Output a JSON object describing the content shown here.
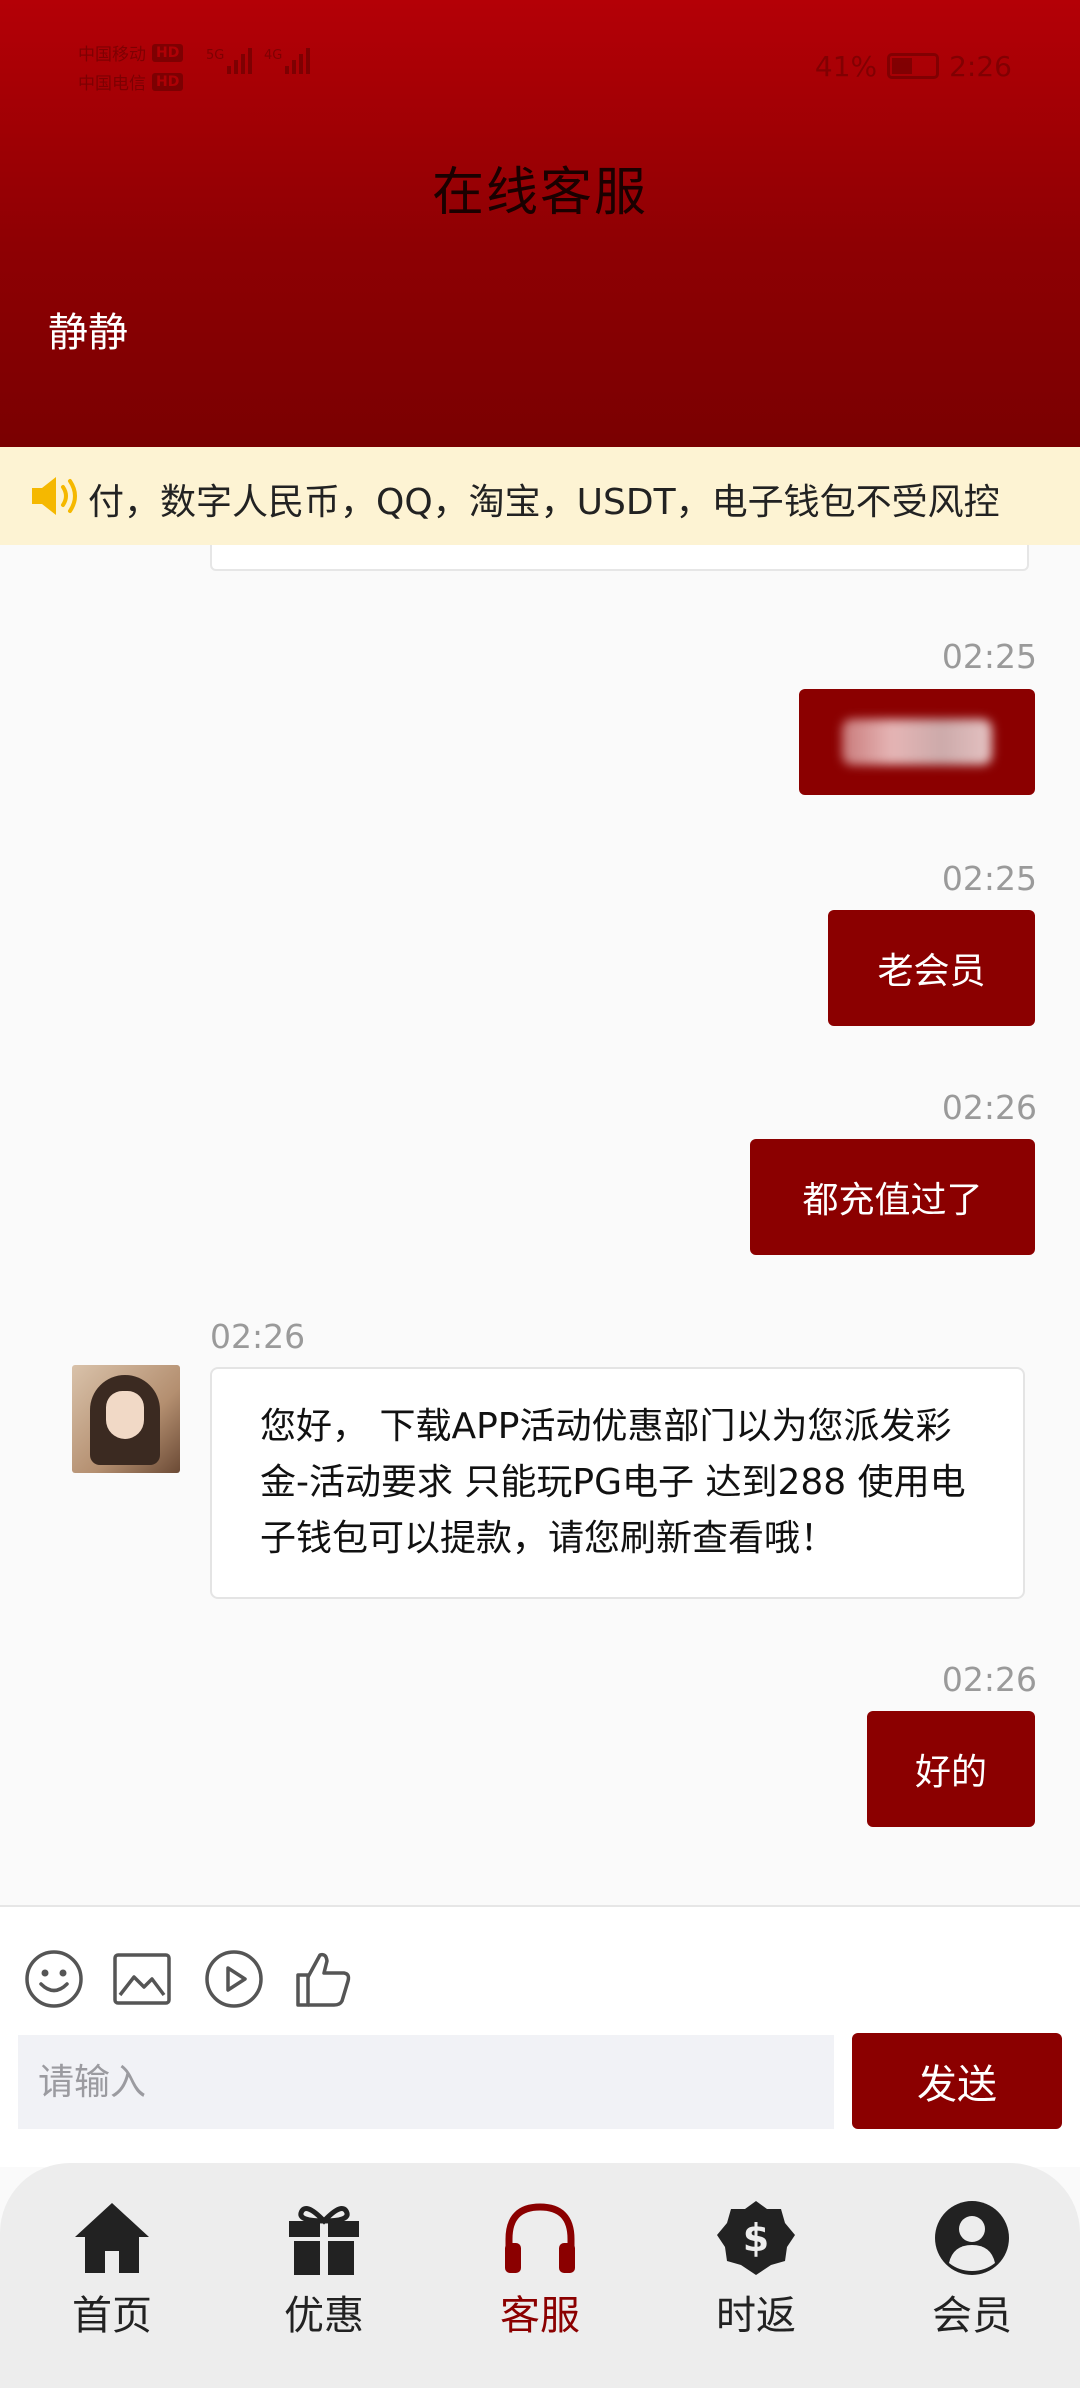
{
  "status_bar": {
    "carrier1": "中国移动",
    "carrier2": "中国电信",
    "net1": "5G",
    "net2": "4G",
    "hd": "HD",
    "battery": "41%",
    "time": "2:26"
  },
  "header": {
    "title": "在线客服",
    "agent_name": "静静"
  },
  "notice": {
    "text": "付，数字人民币，QQ，淘宝，USDT，电子钱包不受风控"
  },
  "messages": [
    {
      "time": "02:25",
      "text": ""
    },
    {
      "time": "02:25",
      "text": "老会员"
    },
    {
      "time": "02:26",
      "text": "都充值过了"
    },
    {
      "time": "02:26",
      "text": "您好， 下载APP活动优惠部门以为您派发彩金-活动要求 只能玩PG电子 达到288 使用电子钱包可以提款，请您刷新查看哦！"
    },
    {
      "time": "02:26",
      "text": "好的"
    }
  ],
  "composer": {
    "placeholder": "请输入",
    "send_label": "发送"
  },
  "nav": [
    {
      "label": "首页",
      "icon": "home-icon"
    },
    {
      "label": "优惠",
      "icon": "gift-icon"
    },
    {
      "label": "客服",
      "icon": "headset-icon",
      "active": true
    },
    {
      "label": "时返",
      "icon": "dollar-badge-icon"
    },
    {
      "label": "会员",
      "icon": "user-icon"
    }
  ],
  "colors": {
    "primary": "#8b0000",
    "header_top": "#b40006",
    "notice_bg": "#fdf3d3"
  }
}
